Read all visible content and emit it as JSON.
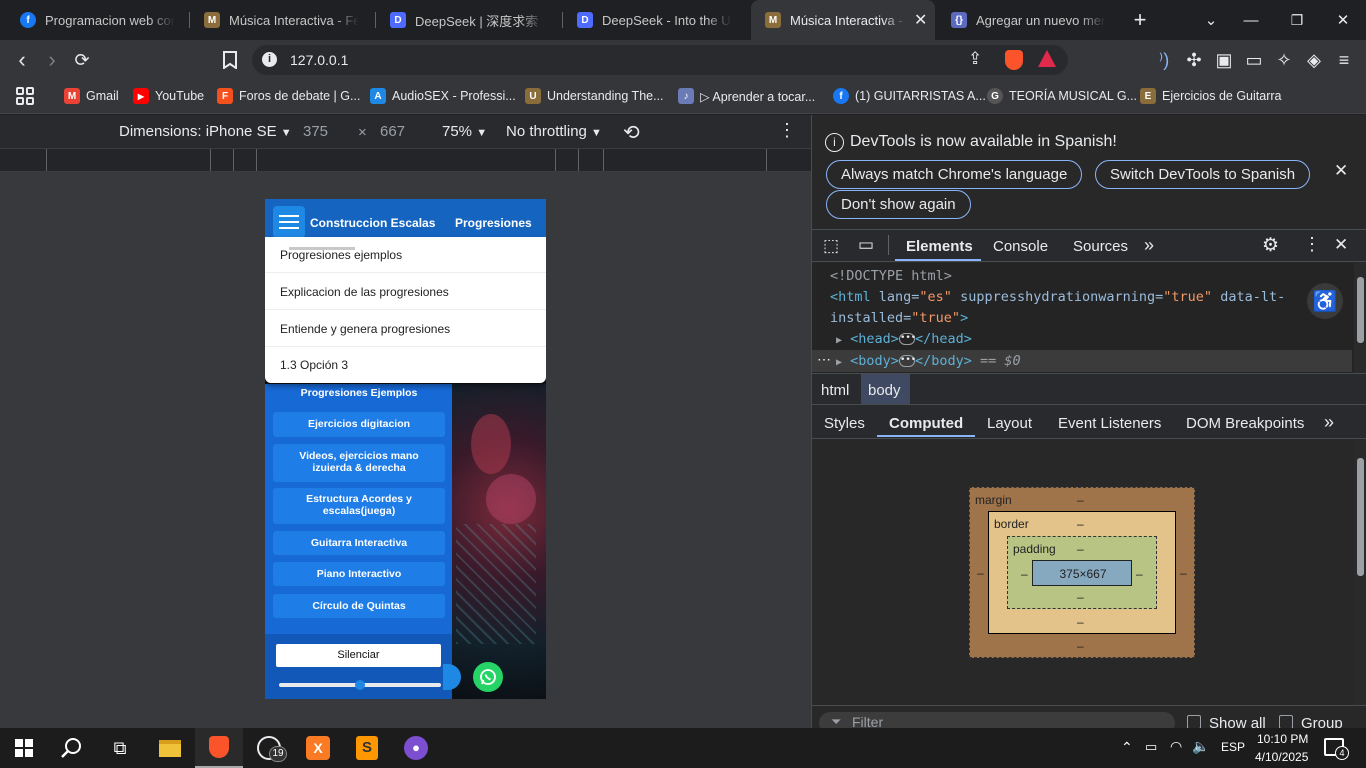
{
  "tabs": [
    {
      "title": "Programacion web con php",
      "fav": "f",
      "color": "#1877f2"
    },
    {
      "title": "Música Interactiva - Felipe",
      "fav": "M",
      "color": "#8a6d3b"
    },
    {
      "title": "DeepSeek | 深度求索",
      "fav": "D",
      "color": "#4d6bfe"
    },
    {
      "title": "DeepSeek - Into the Unknown",
      "fav": "D",
      "color": "#4d6bfe"
    },
    {
      "title": "Música Interactiva - Felipe",
      "fav": "M",
      "color": "#8a6d3b",
      "active": true
    },
    {
      "title": "Agregar un nuevo mensaje",
      "fav": "{}",
      "color": "#5c6bc0"
    }
  ],
  "toolbar": {
    "url": "127.0.0.1"
  },
  "bookmarks": [
    {
      "label": "Gmail",
      "fav": "M",
      "color": "#ea4335"
    },
    {
      "label": "YouTube",
      "fav": "▶",
      "color": "#ff0000"
    },
    {
      "label": "Foros de debate | G...",
      "fav": "F",
      "color": "#f4511e"
    },
    {
      "label": "AudioSEX - Professi...",
      "fav": "A",
      "color": "#1e88e5"
    },
    {
      "label": "Understanding The...",
      "fav": "U",
      "color": "#8a6d3b"
    },
    {
      "label": "▷ Aprender a tocar...",
      "fav": "♪",
      "color": "#6a7bb5"
    },
    {
      "label": "(1) GUITARRISTAS A...",
      "fav": "f",
      "color": "#1877f2"
    },
    {
      "label": "TEORÍA MUSICAL G...",
      "fav": "G",
      "color": "#555"
    },
    {
      "label": "Ejercicios de Guitarra",
      "fav": "E",
      "color": "#8a6d3b"
    }
  ],
  "devbar": {
    "dimensions": "Dimensions: iPhone SE",
    "width": "375",
    "times": "×",
    "height": "667",
    "zoom": "75%",
    "throttle": "No throttling"
  },
  "phone": {
    "nav_links": [
      "Construccion Escalas",
      "Progresiones"
    ],
    "dropdown": [
      "Progresiones ejemplos",
      "Explicacion de las progresiones",
      "Entiende y genera progresiones",
      "1.3 Opción 3"
    ],
    "menu": [
      "Progresiones Ejemplos",
      "Ejercicios digitacion",
      "Videos, ejercicios mano izuierda & derecha",
      "Estructura Acordes y escalas(juega)",
      "Guitarra Interactiva",
      "Piano Interactivo",
      "Círculo de Quintas"
    ],
    "mute": "Silenciar",
    "volume": 0.5
  },
  "devtools": {
    "notice": "DevTools is now available in Spanish!",
    "btn_match": "Always match Chrome's language",
    "btn_switch": "Switch DevTools to Spanish",
    "btn_dont": "Don't show again",
    "tabs": [
      "Elements",
      "Console",
      "Sources"
    ],
    "dom": {
      "doctype": "<!DOCTYPE html>",
      "html_open": "<html",
      "lang_attr": "lang=",
      "lang_val": "\"es\"",
      "shw_attr": "suppresshydrationwarning=",
      "shw_val": "\"true\"",
      "lt_attr": "data-lt-",
      "lt_attr2": "installed=",
      "lt_val": "\"true\"",
      "close_bracket": ">",
      "head_open": "<head>",
      "head_close": "</head>",
      "body_open": "<body>",
      "body_close": "</body>",
      "body_eq": "== $0"
    },
    "breadcrumb": [
      "html",
      "body"
    ],
    "subtabs": [
      "Styles",
      "Computed",
      "Layout",
      "Event Listeners",
      "DOM Breakpoints"
    ],
    "boxmodel": {
      "margin": "margin",
      "border": "border",
      "padding": "padding",
      "content": "375×667",
      "dash": "–"
    },
    "filter": "Filter",
    "show_all": "Show all",
    "group": "Group"
  },
  "taskbar": {
    "lang": "ESP",
    "time": "10:10 PM",
    "date": "4/10/2025",
    "whatsapp_badge": "19",
    "notif": "4"
  }
}
